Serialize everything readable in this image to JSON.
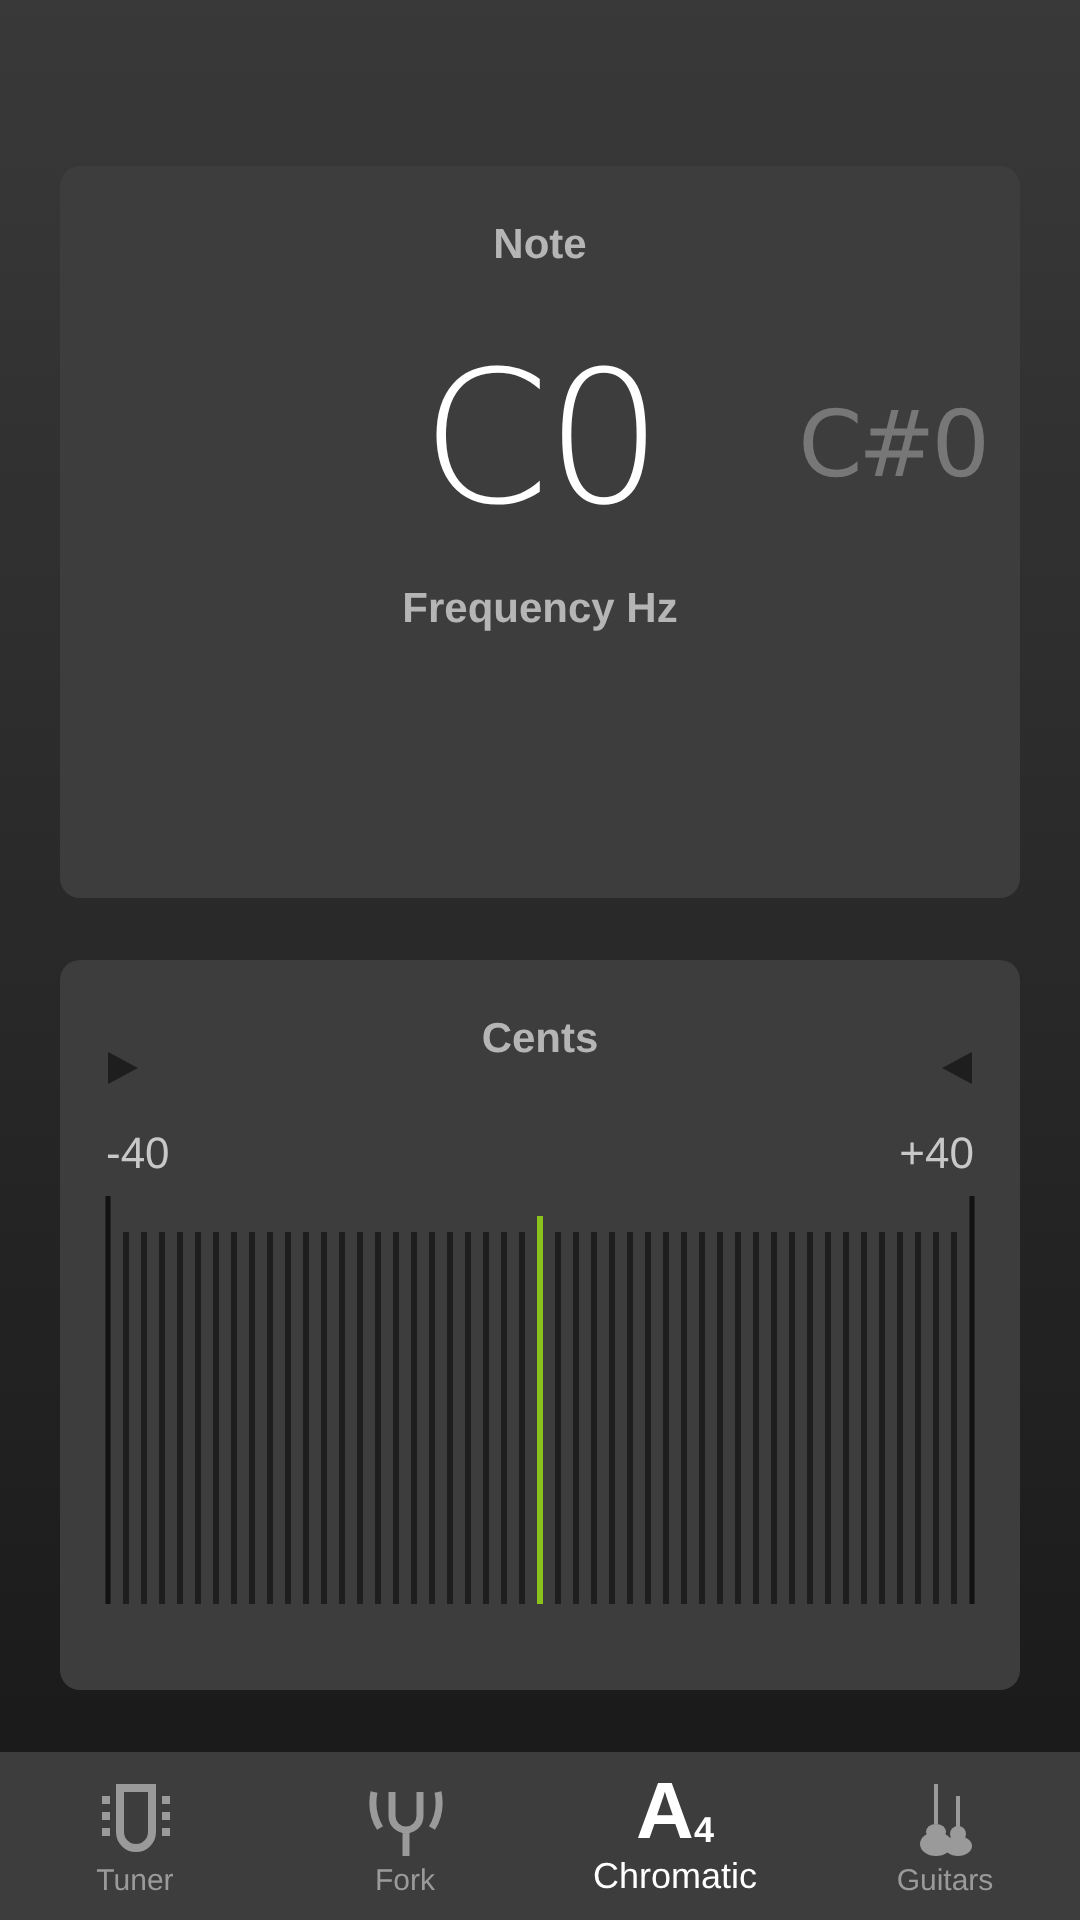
{
  "note_card": {
    "title": "Note",
    "note": "C0",
    "next_note": "C#0",
    "frequency_label": "Frequency Hz"
  },
  "cents_card": {
    "title": "Cents",
    "min_label": "-40",
    "max_label": "+40"
  },
  "tabs": [
    {
      "label": "Tuner",
      "kind": "tuner",
      "selected": false
    },
    {
      "label": "Fork",
      "kind": "fork",
      "selected": false
    },
    {
      "label": "Chromatic",
      "kind": "chromatic",
      "glyph": "A",
      "glyph_sub": "4",
      "selected": true
    },
    {
      "label": "Guitars",
      "kind": "guitars",
      "selected": false
    }
  ]
}
